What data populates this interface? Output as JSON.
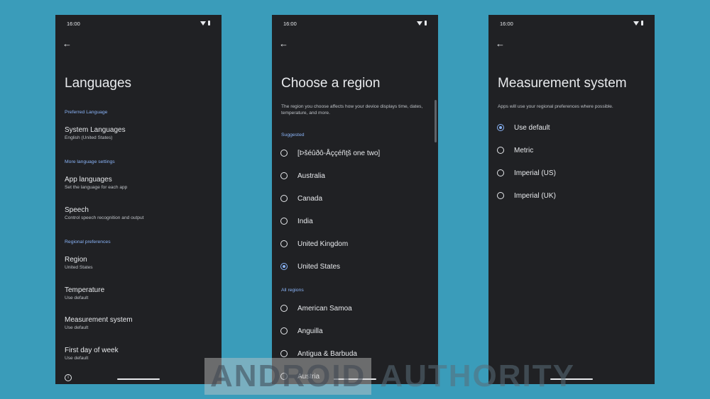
{
  "status": {
    "time": "16:00"
  },
  "languages": {
    "title": "Languages",
    "preferred_header": "Preferred Language",
    "system_languages": {
      "title": "System Languages",
      "subtitle": "English (United States)"
    },
    "more_header": "More language settings",
    "app_languages": {
      "title": "App languages",
      "subtitle": "Set the language for each app"
    },
    "speech": {
      "title": "Speech",
      "subtitle": "Control speech recognition and output"
    },
    "regional_header": "Regional preferences",
    "region": {
      "title": "Region",
      "subtitle": "United States"
    },
    "temperature": {
      "title": "Temperature",
      "subtitle": "Use default"
    },
    "measurement": {
      "title": "Measurement system",
      "subtitle": "Use default"
    },
    "first_day": {
      "title": "First day of week",
      "subtitle": "Use default"
    },
    "info_glyph": "i"
  },
  "region": {
    "title": "Choose a region",
    "description": "The region you choose affects how your device displays time, dates, temperature, and more.",
    "suggested_header": "Suggested",
    "suggested": [
      "[Þšéûðô-Åççéñţš one two]",
      "Australia",
      "Canada",
      "India",
      "United Kingdom",
      "United States"
    ],
    "selected": "United States",
    "all_header": "All regions",
    "all": [
      "American Samoa",
      "Anguilla",
      "Antigua & Barbuda",
      "Austria"
    ]
  },
  "measurement": {
    "title": "Measurement system",
    "description": "Apps will use your regional preferences where possible.",
    "options": [
      "Use default",
      "Metric",
      "Imperial (US)",
      "Imperial (UK)"
    ],
    "selected": "Use default"
  },
  "watermark": {
    "part1": "ANDROID",
    "part2": "AUTHORITY"
  },
  "colors": {
    "background": "#3a9cba",
    "phone": "#202124",
    "accent": "#8ab4f8"
  }
}
